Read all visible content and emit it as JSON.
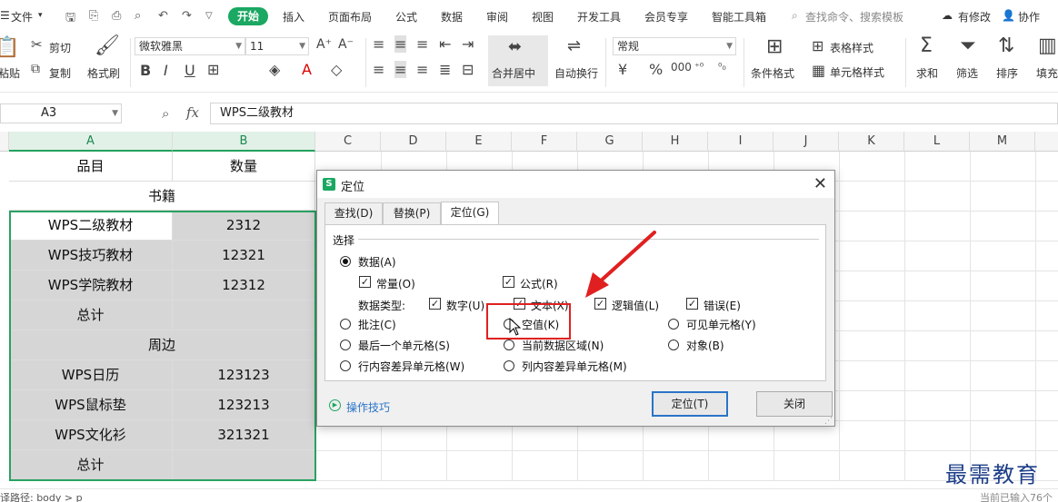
{
  "menubar": {
    "file": "文件",
    "tabs": [
      "开始",
      "插入",
      "页面布局",
      "公式",
      "数据",
      "审阅",
      "视图",
      "开发工具",
      "会员专享",
      "智能工具箱"
    ],
    "search_placeholder": "查找命令、搜索模板",
    "modified": "有修改",
    "collab": "协作"
  },
  "ribbon": {
    "paste": "粘贴",
    "cut": "剪切",
    "copy": "复制",
    "format_painter": "格式刷",
    "font_name": "微软雅黑",
    "font_size": "11",
    "merge_center": "合并居中",
    "wrap_text": "自动换行",
    "number_format": "常规",
    "conditional_format": "条件格式",
    "table_style": "表格样式",
    "cell_style": "单元格样式",
    "sum": "求和",
    "filter": "筛选",
    "sort": "排序",
    "fill": "填充"
  },
  "formula_bar": {
    "name_box": "A3",
    "fx": "fx",
    "content": "WPS二级教材"
  },
  "grid": {
    "columns": [
      "A",
      "B",
      "C",
      "D",
      "E",
      "F",
      "G",
      "H",
      "I",
      "J",
      "K",
      "L",
      "M"
    ],
    "rows": [
      {
        "a": "品目",
        "b": "数量"
      },
      {
        "merged": "书籍"
      },
      {
        "a": "WPS二级教材",
        "b": "2312"
      },
      {
        "a": "WPS技巧教材",
        "b": "12321"
      },
      {
        "a": "WPS学院教材",
        "b": "12312"
      },
      {
        "a": "总计",
        "b": ""
      },
      {
        "merged": "周边"
      },
      {
        "a": "WPS日历",
        "b": "123123"
      },
      {
        "a": "WPS鼠标垫",
        "b": "123213"
      },
      {
        "a": "WPS文化衫",
        "b": "321321"
      },
      {
        "a": "总计",
        "b": ""
      }
    ]
  },
  "dialog": {
    "title": "定位",
    "tabs": [
      "查找(D)",
      "替换(P)",
      "定位(G)"
    ],
    "group": "选择",
    "data": "数据(A)",
    "constant": "常量(O)",
    "formula": "公式(R)",
    "data_type": "数据类型:",
    "number": "数字(U)",
    "text": "文本(X)",
    "logical": "逻辑值(L)",
    "error": "错误(E)",
    "comment": "批注(C)",
    "blank": "空值(K)",
    "visible": "可见单元格(Y)",
    "last_cell": "最后一个单元格(S)",
    "current_region": "当前数据区域(N)",
    "object": "对象(B)",
    "row_diff": "行内容差异单元格(W)",
    "col_diff": "列内容差异单元格(M)",
    "tips": "操作技巧",
    "goto": "定位(T)",
    "close": "关闭"
  },
  "status": {
    "path": "译路径: body > p",
    "right": "当前已输入76个"
  },
  "watermark": "最需教育",
  "colors": {
    "accent": "#1aa862",
    "selection": "#2aa163",
    "highlight": "#e02020"
  }
}
